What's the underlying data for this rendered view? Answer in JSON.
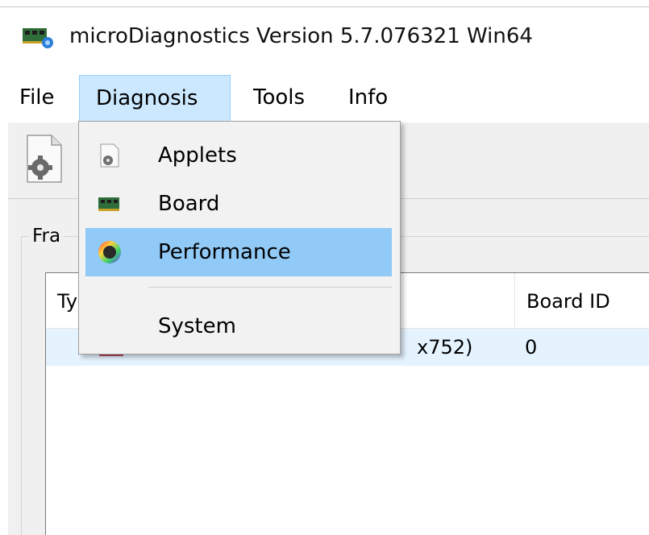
{
  "window": {
    "title": "microDiagnostics Version 5.7.076321 Win64"
  },
  "menubar": {
    "items": [
      {
        "label": "File"
      },
      {
        "label": "Diagnosis",
        "active": true
      },
      {
        "label": "Tools"
      },
      {
        "label": "Info"
      }
    ]
  },
  "dropdown": {
    "items": [
      {
        "label": "Applets",
        "icon": "applets-icon"
      },
      {
        "label": "Board",
        "icon": "board-icon"
      },
      {
        "label": "Performance",
        "icon": "performance-icon",
        "highlighted": true
      },
      {
        "label": "System"
      }
    ]
  },
  "group": {
    "label": "Fra"
  },
  "table": {
    "columns": [
      "Ty",
      "Board ID"
    ],
    "rows": [
      {
        "type": "x752)",
        "board_id": "0"
      }
    ]
  },
  "colors": {
    "menu_active": "#cce8ff",
    "dropdown_highlight": "#91c9f7",
    "row_selected": "#e5f3ff",
    "panel_bg": "#f0f0f0"
  }
}
